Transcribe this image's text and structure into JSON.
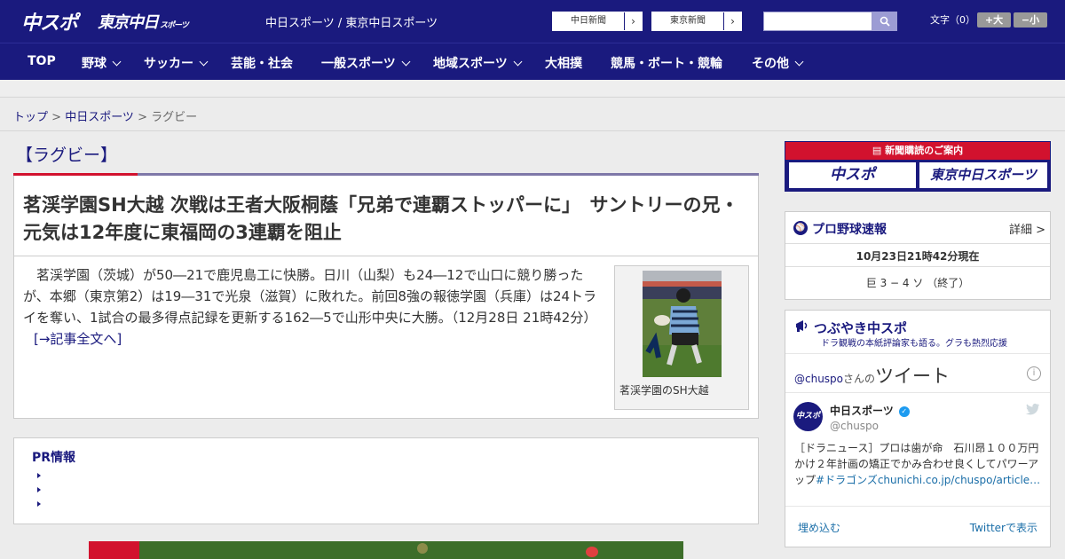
{
  "header": {
    "logo_chuspo": "中スポ",
    "logo_tokyo": "東京中日",
    "logo_tokyo_sub": "スポーツ",
    "site_title": "中日スポーツ / 東京中日スポーツ",
    "link_chunichi": "中日新聞",
    "link_tokyo": "東京新聞",
    "link_arrow": "›",
    "search_placeholder": "",
    "font_size_label": "文字（0）",
    "font_bigger": "+大",
    "font_smaller": "−小"
  },
  "nav": {
    "items": [
      {
        "label": "TOP"
      },
      {
        "label": "野球"
      },
      {
        "label": "サッカー"
      },
      {
        "label": "芸能・社会"
      },
      {
        "label": "一般スポーツ"
      },
      {
        "label": "地域スポーツ"
      },
      {
        "label": "大相撲"
      },
      {
        "label": "競馬・ボート・競輪"
      },
      {
        "label": "その他"
      }
    ]
  },
  "breadcrumb": {
    "home": "トップ",
    "sep": " > ",
    "section": "中日スポーツ",
    "current": "ラグビー"
  },
  "article": {
    "section_title": "【ラグビー】",
    "headline": "茗渓学園SH大越 次戦は王者大阪桐蔭「兄弟で連覇ストッパーに」　サントリーの兄・元気は12年度に東福岡の3連覇を阻止",
    "body": "　茗渓学園（茨城）が50―21で鹿児島工に快勝。日川（山梨）も24―12で山口に競り勝ったが、本郷（東京第2）は19―31で光泉（滋賀）に敗れた。前回8強の報徳学園（兵庫）は24トライを奪い、1試合の最多得点記録を更新する162―5で山形中央に大勝。（12月28日 21時42分）",
    "read_more": "[→記事全文へ]",
    "photo_caption": "茗渓学園のSH大越"
  },
  "pr": {
    "title": "PR情報"
  },
  "sidebar": {
    "subscription_title": "新聞購読のご案内",
    "sub_logo_chuspo": "中スポ",
    "sub_logo_tokyo": "東京中日スポーツ",
    "baseball": {
      "title": "プロ野球速報",
      "detail": "詳細 >",
      "timestamp": "10月23日21時42分現在",
      "score": "巨 3 − 4 ソ （終了）"
    },
    "twitter": {
      "title": "つぶやき中スポ",
      "subtitle": "ドラ観戦の本紙評論家も語る。グラも熱烈応援",
      "handle": "@chuspo",
      "san": "さんの",
      "tweet_label": "ツイート",
      "account_name": "中日スポーツ",
      "account_at": "@chuspo",
      "tweet_text": "［ドラニュース］プロは歯が命　石川昂１００万円かけ２年計画の矯正でかみ合わせ良くしてパワーアップ",
      "tweet_link": "#ドラゴンズchunichi.co.jp/chuspo/article…",
      "embed": "埋め込む",
      "view_on": "Twitterで表示"
    }
  },
  "colors": {
    "brand_navy": "#1a1a7e",
    "accent_red": "#d2122e"
  }
}
